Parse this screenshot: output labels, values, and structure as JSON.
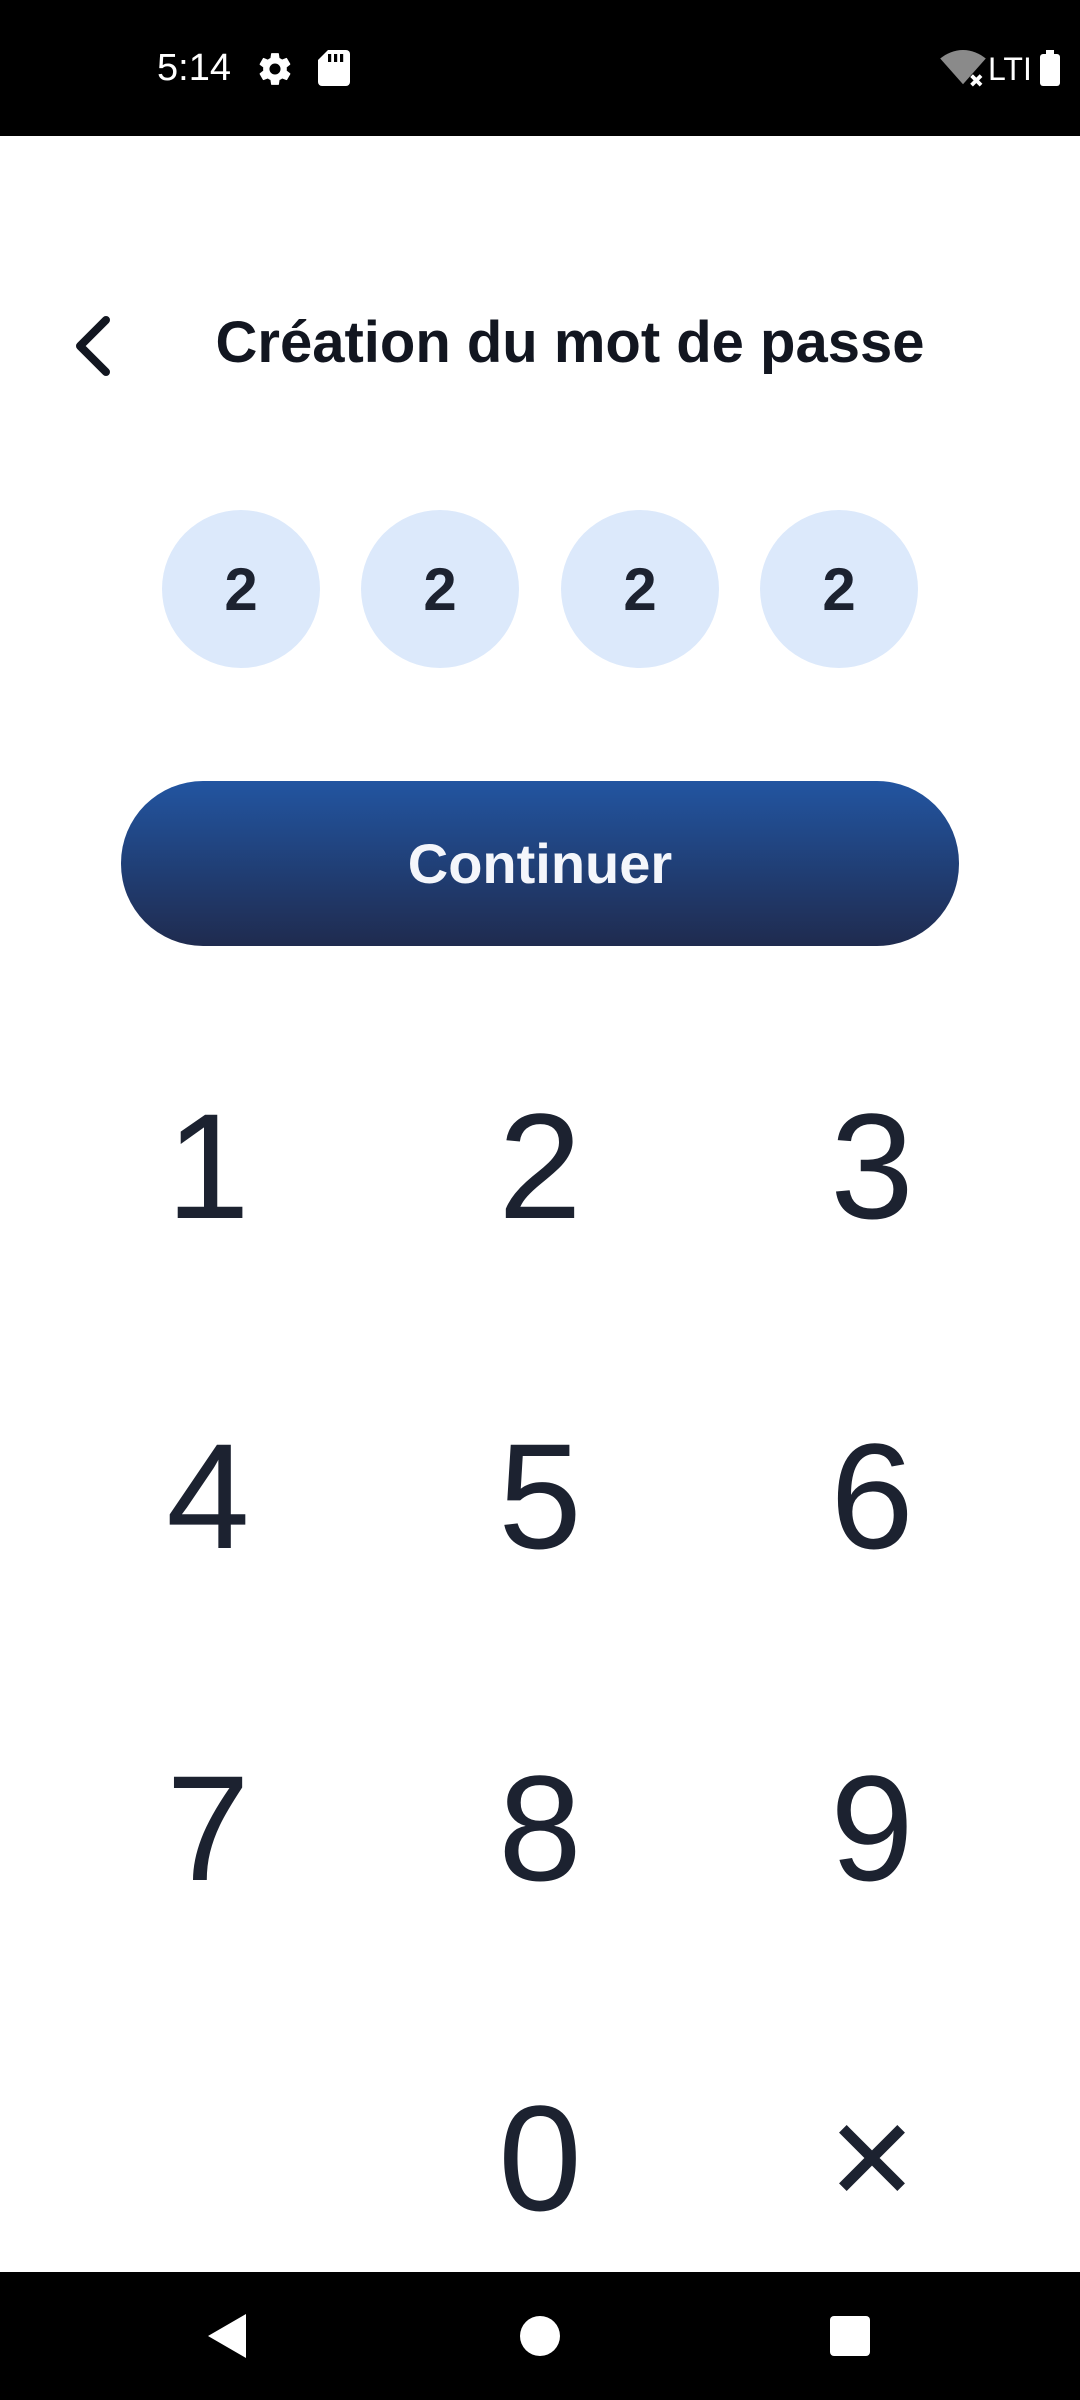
{
  "status_bar": {
    "time": "5:14",
    "network_label": "LTI",
    "icons": [
      "gear-icon",
      "sd-card-icon",
      "wifi-no-internet-icon",
      "battery-icon"
    ]
  },
  "header": {
    "title": "Création du mot de passe",
    "back_icon": "chevron-left-icon"
  },
  "pin": {
    "digits": [
      "2",
      "2",
      "2",
      "2"
    ]
  },
  "continue_button": {
    "label": "Continuer"
  },
  "keypad": {
    "keys": [
      "1",
      "2",
      "3",
      "4",
      "5",
      "6",
      "7",
      "8",
      "9",
      "0"
    ],
    "delete_icon": "close-icon"
  },
  "nav_bar": {
    "buttons": [
      "back-triangle-icon",
      "home-circle-icon",
      "recents-square-icon"
    ]
  },
  "colors": {
    "pin_dot_background": "#dce9fb",
    "button_gradient_top": "#2255a1",
    "button_gradient_bottom": "#1f2b4f",
    "text_dark": "#1c2230"
  }
}
